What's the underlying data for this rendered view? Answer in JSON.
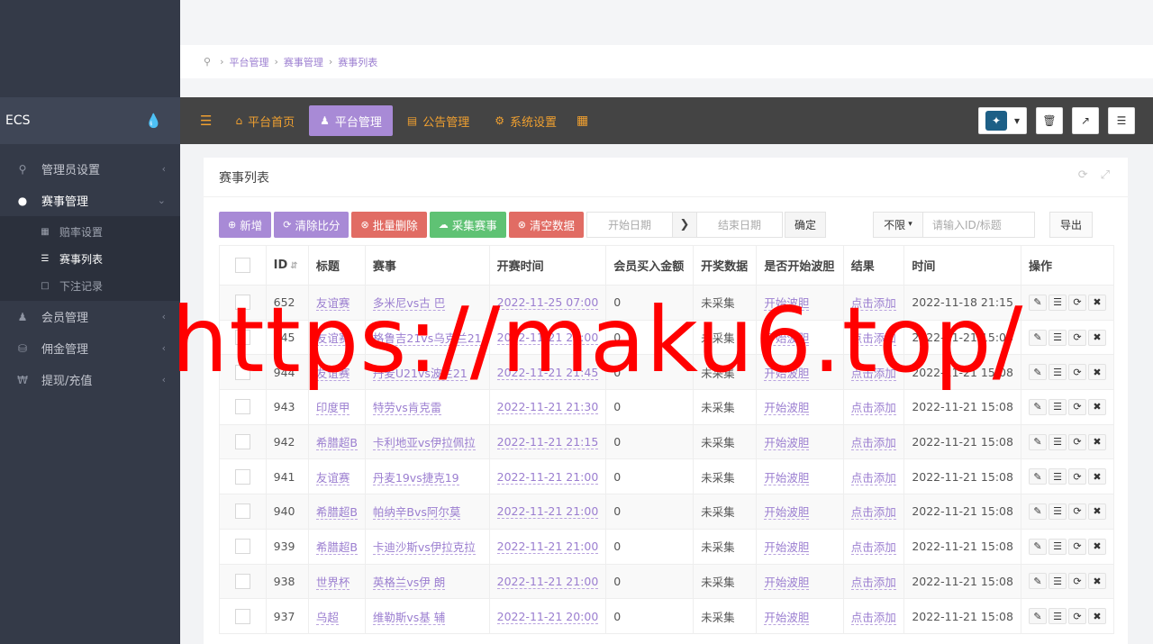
{
  "sidebar": {
    "brand": "ECS",
    "brand_icon": "drop-icon",
    "menu": [
      {
        "label": "管理员设置",
        "icon": "key-icon"
      },
      {
        "label": "赛事管理",
        "icon": "users-icon"
      },
      {
        "label": "会员管理",
        "icon": "user-icon"
      },
      {
        "label": "佣金管理",
        "icon": "database-icon"
      },
      {
        "label": "提现/充值",
        "icon": "yen-icon"
      }
    ],
    "submenu": [
      {
        "label": "赔率设置"
      },
      {
        "label": "赛事列表"
      },
      {
        "label": "下注记录"
      }
    ]
  },
  "breadcrumb": [
    "平台管理",
    "赛事管理",
    "赛事列表"
  ],
  "navbar": {
    "items": [
      {
        "label": "平台首页",
        "icon": "home-icon"
      },
      {
        "label": "平台管理",
        "icon": "user-icon"
      },
      {
        "label": "公告管理",
        "icon": "list-icon"
      },
      {
        "label": "系统设置",
        "icon": "gear-icon"
      }
    ]
  },
  "card": {
    "title": "赛事列表"
  },
  "toolbar": {
    "add": "新增",
    "clear_score": "清除比分",
    "batch_delete": "批量删除",
    "collect": "采集赛事",
    "clear_data": "清空数据",
    "start_date": "开始日期",
    "end_date": "结束日期",
    "confirm": "确定",
    "filter": "不限",
    "search_placeholder": "请输入ID/标题",
    "export": "导出"
  },
  "table": {
    "columns": [
      "ID",
      "标题",
      "赛事",
      "开赛时间",
      "会员买入金额",
      "开奖数据",
      "是否开始波胆",
      "结果",
      "时间",
      "操作"
    ],
    "rows": [
      {
        "id": "652",
        "title": "友谊赛",
        "match": "多米尼vs古 巴",
        "start": "2022-11-25 07:00",
        "amount": "0",
        "draw": "未采集",
        "bodan": "开始波胆",
        "result": "点击添加",
        "time": "2022-11-18 21:15"
      },
      {
        "id": "945",
        "title": "友谊赛",
        "match": "格鲁吉21vs乌克兰21",
        "start": "2022-11-21 22:00",
        "amount": "0",
        "draw": "未采集",
        "bodan": "开始波胆",
        "result": "点击添加",
        "time": "2022-11-21 15:08"
      },
      {
        "id": "944",
        "title": "友谊赛",
        "match": "丹麦U21vs波兰21",
        "start": "2022-11-21 21:45",
        "amount": "0",
        "draw": "未采集",
        "bodan": "开始波胆",
        "result": "点击添加",
        "time": "2022-11-21 15:08"
      },
      {
        "id": "943",
        "title": "印度甲",
        "match": "特劳vs肯克雷",
        "start": "2022-11-21 21:30",
        "amount": "0",
        "draw": "未采集",
        "bodan": "开始波胆",
        "result": "点击添加",
        "time": "2022-11-21 15:08"
      },
      {
        "id": "942",
        "title": "希腊超B",
        "match": "卡利地亚vs伊拉佩拉",
        "start": "2022-11-21 21:15",
        "amount": "0",
        "draw": "未采集",
        "bodan": "开始波胆",
        "result": "点击添加",
        "time": "2022-11-21 15:08"
      },
      {
        "id": "941",
        "title": "友谊赛",
        "match": "丹麦19vs捷克19",
        "start": "2022-11-21 21:00",
        "amount": "0",
        "draw": "未采集",
        "bodan": "开始波胆",
        "result": "点击添加",
        "time": "2022-11-21 15:08"
      },
      {
        "id": "940",
        "title": "希腊超B",
        "match": "帕纳辛Bvs阿尔莫",
        "start": "2022-11-21 21:00",
        "amount": "0",
        "draw": "未采集",
        "bodan": "开始波胆",
        "result": "点击添加",
        "time": "2022-11-21 15:08"
      },
      {
        "id": "939",
        "title": "希腊超B",
        "match": "卡迪沙斯vs伊拉克拉",
        "start": "2022-11-21 21:00",
        "amount": "0",
        "draw": "未采集",
        "bodan": "开始波胆",
        "result": "点击添加",
        "time": "2022-11-21 15:08"
      },
      {
        "id": "938",
        "title": "世界杯",
        "match": "英格兰vs伊 朗",
        "start": "2022-11-21 21:00",
        "amount": "0",
        "draw": "未采集",
        "bodan": "开始波胆",
        "result": "点击添加",
        "time": "2022-11-21 15:08"
      },
      {
        "id": "937",
        "title": "乌超",
        "match": "维勒斯vs基 辅",
        "start": "2022-11-21 20:00",
        "amount": "0",
        "draw": "未采集",
        "bodan": "开始波胆",
        "result": "点击添加",
        "time": "2022-11-21 15:08"
      }
    ]
  },
  "watermark": "https://maku6.top/"
}
